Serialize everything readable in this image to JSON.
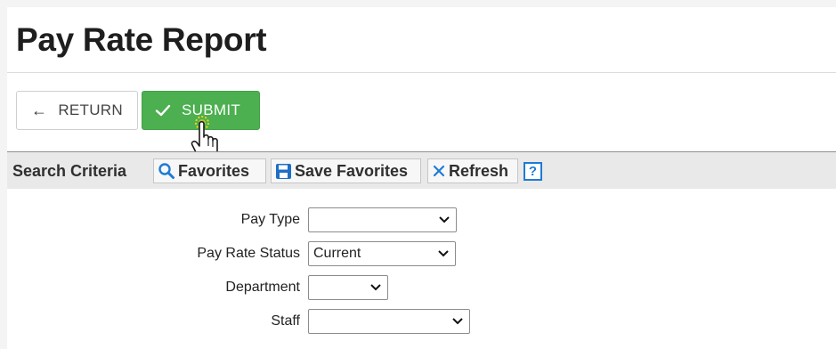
{
  "page": {
    "title": "Pay Rate Report"
  },
  "toolbar": {
    "return_label": "RETURN",
    "submit_label": "SUBMIT"
  },
  "criteria": {
    "label": "Search Criteria",
    "favorites_label": "Favorites",
    "save_favorites_label": "Save Favorites",
    "refresh_label": "Refresh",
    "help_label": "?"
  },
  "form": {
    "pay_type": {
      "label": "Pay Type",
      "value": ""
    },
    "pay_rate_status": {
      "label": "Pay Rate Status",
      "value": "Current"
    },
    "department": {
      "label": "Department",
      "value": ""
    },
    "staff": {
      "label": "Staff",
      "value": ""
    }
  },
  "colors": {
    "submit": "#4caf50",
    "help_accent": "#1e7bd6",
    "favorites_icon": "#1e7bd6",
    "save_icon": "#1e6fc4",
    "refresh_icon": "#1e7bd6",
    "cursor_highlight": "#f2d21b"
  },
  "icons": {
    "return": "arrow-left-icon",
    "submit": "check-icon",
    "favorites": "search-icon",
    "save": "floppy-disk-icon",
    "refresh": "close-x-icon",
    "help": "help-icon",
    "cursor": "hand-pointer-icon"
  }
}
